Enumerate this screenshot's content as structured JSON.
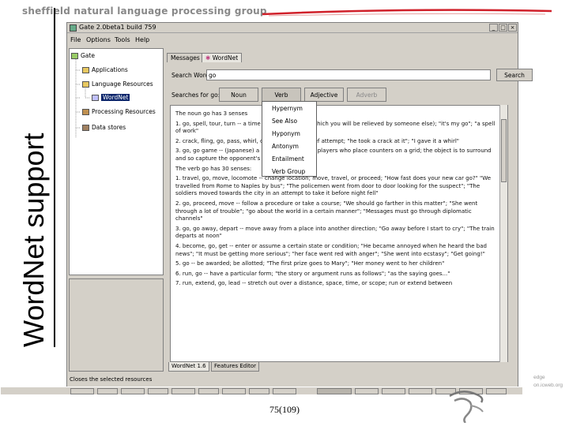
{
  "slide": {
    "header": "sheffield natural language processing group",
    "side_title": "WordNet support",
    "page_number": "75(109)",
    "watermark_lines": [
      "edge",
      "on.icweb.org"
    ]
  },
  "app": {
    "title": "Gate 2.0beta1 build 759",
    "menu": [
      "File",
      "Options",
      "Tools",
      "Help"
    ],
    "tree": [
      {
        "label": "Gate",
        "icon": "gate-icon"
      },
      {
        "label": "Applications",
        "icon": "folder-icon"
      },
      {
        "label": "Language Resources",
        "icon": "folder-icon"
      },
      {
        "label": "WordNet",
        "icon": "wordnet-icon",
        "selected": true
      },
      {
        "label": "Processing Resources",
        "icon": "gear-icon"
      },
      {
        "label": "Data stores",
        "icon": "database-icon"
      }
    ],
    "tabs": [
      "Messages",
      "WordNet"
    ],
    "search_label": "Search Word:",
    "search_value": "go",
    "search_button": "Search",
    "searches_for_label": "Searches for go:",
    "pos_buttons": [
      "Noun",
      "Verb",
      "Adjective",
      "Adverb"
    ],
    "popup_items": [
      "Hypernym",
      "See Also",
      "Hyponym",
      "Antonym",
      "Entailment",
      "Verb Group"
    ],
    "results": [
      "The noun go has 3 senses",
      "1. go, spell, tour, turn -- a time for working (after which you will be relieved by someone else); \"it's my go\"; \"a spell of work\"",
      "2. crack, fling, go, pass, whirl, offer -- a usually brief attempt; \"he took a crack at it\"; \"I gave it a whirl\"",
      "3. go, go game -- (Japanese) a board game for two players who place counters on a grid; the object is to surround and so capture the opponent's counters",
      "The verb go has 30 senses:",
      "1. travel, go, move, locomote -- change location; move, travel, or proceed; \"How fast does your new car go?\" \"We travelled from Rome to Naples by bus\"; \"The policemen went from door to door looking for the suspect\"; \"The soldiers moved towards the city in an attempt to take it before night fell\"",
      "2. go, proceed, move -- follow a procedure or take a course; \"We should go farther in this matter\"; \"She went through a lot of trouble\"; \"go about the world in a certain manner\"; \"Messages must go through diplomatic channels\"",
      "3. go, go away, depart -- move away from a place into another direction; \"Go away before I start to cry\"; \"The train departs at noon\"",
      "4. become, go, get -- enter or assume a certain state or condition; \"He became annoyed when he heard the bad news\"; \"It must be getting more serious\"; \"her face went red with anger\"; \"She went into ecstasy\"; \"Get going!\"",
      "5. go -- be awarded; be allotted; \"The first prize goes to Mary\"; \"Her money went to her children\"",
      "6. run, go -- have a particular form; \"the story or argument runs as follows\"; \"as the saying goes...\"",
      "7. run, extend, go, lead -- stretch out over a distance, space, time, or scope; run or extend between"
    ],
    "bottom_tabs": [
      "WordNet 1.6",
      "Features Editor"
    ],
    "status_text": "Closes the selected resources"
  }
}
